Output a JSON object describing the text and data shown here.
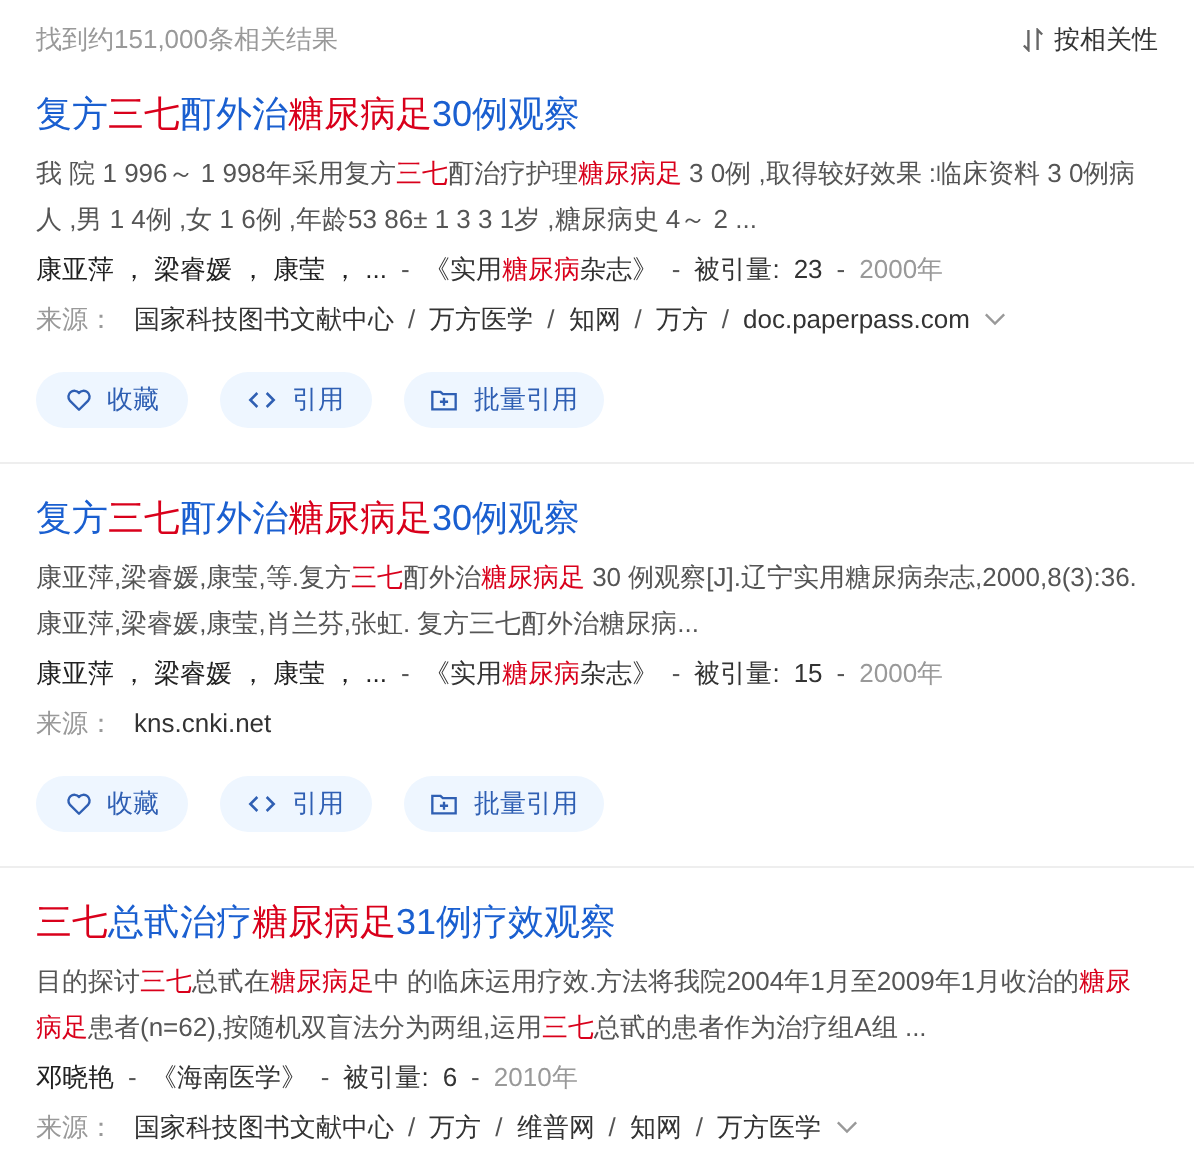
{
  "header": {
    "count_text": "找到约151,000条相关结果",
    "sort_label": "按相关性"
  },
  "results": [
    {
      "title": [
        {
          "text": "复方",
          "hl": false
        },
        {
          "text": "三七",
          "hl": true
        },
        {
          "text": "酊外治",
          "hl": false
        },
        {
          "text": "糖尿病足",
          "hl": true
        },
        {
          "text": "30例观察",
          "hl": false
        }
      ],
      "abstract": [
        {
          "text": "我 院 1 996～ 1 998年采用复方",
          "hl": false
        },
        {
          "text": "三七",
          "hl": true
        },
        {
          "text": "酊治疗护理",
          "hl": false
        },
        {
          "text": "糖尿病足",
          "hl": true
        },
        {
          "text": " 3 0例 ,取得较好效果 :临床资料 3 0例病人 ,男 1 4例 ,女 1 6例 ,年龄53 86± 1 3 3 1岁 ,糖尿病史 4～ 2 ...",
          "hl": false
        }
      ],
      "authors": "康亚萍 ， 梁睿媛 ， 康莹 ， ...",
      "journal": [
        {
          "text": "《实用",
          "hl": false
        },
        {
          "text": "糖尿病",
          "hl": true
        },
        {
          "text": "杂志》",
          "hl": false
        }
      ],
      "cited_label": "被引量:",
      "cited": "23",
      "year": "2000年",
      "meta_separators": [
        "-",
        "-",
        "-"
      ],
      "source_label": "来源：",
      "sources": [
        "国家科技图书文献中心",
        "万方医学",
        "知网",
        "万方",
        "doc.paperpass.com"
      ],
      "source_separators": [
        "/",
        "/",
        "/",
        "/"
      ],
      "sources_expandable": true,
      "actions": [
        {
          "kind": "favorite",
          "label": "收藏"
        },
        {
          "kind": "cite",
          "label": "引用"
        },
        {
          "kind": "batch",
          "label": "批量引用"
        }
      ]
    },
    {
      "title": [
        {
          "text": "复方",
          "hl": false
        },
        {
          "text": "三七",
          "hl": true
        },
        {
          "text": "酊外治",
          "hl": false
        },
        {
          "text": "糖尿病足",
          "hl": true
        },
        {
          "text": "30例观察",
          "hl": false
        }
      ],
      "abstract": [
        {
          "text": "康亚萍,梁睿媛,康莹,等.复方",
          "hl": false
        },
        {
          "text": "三七",
          "hl": true
        },
        {
          "text": "酊外治",
          "hl": false
        },
        {
          "text": "糖尿病足",
          "hl": true
        },
        {
          "text": " 30 例观察[J].辽宁实用糖尿病杂志,2000,8(3):36.康亚萍,梁睿媛,康莹,肖兰芬,张虹. 复方三七酊外治糖尿病...",
          "hl": false
        }
      ],
      "authors": "康亚萍 ， 梁睿媛 ， 康莹 ， ...",
      "journal": [
        {
          "text": "《实用",
          "hl": false
        },
        {
          "text": "糖尿病",
          "hl": true
        },
        {
          "text": "杂志》",
          "hl": false
        }
      ],
      "cited_label": "被引量:",
      "cited": "15",
      "year": "2000年",
      "meta_separators": [
        "-",
        "-",
        "-"
      ],
      "source_label": "来源：",
      "sources": [
        "kns.cnki.net"
      ],
      "sources_expandable": false,
      "actions": [
        {
          "kind": "favorite",
          "label": "收藏"
        },
        {
          "kind": "cite",
          "label": "引用"
        },
        {
          "kind": "batch",
          "label": "批量引用"
        }
      ]
    },
    {
      "title": [
        {
          "text": "三七",
          "hl": true
        },
        {
          "text": "总甙治疗",
          "hl": false
        },
        {
          "text": "糖尿病足",
          "hl": true
        },
        {
          "text": "31例疗效观察",
          "hl": false
        }
      ],
      "abstract": [
        {
          "text": "目的探讨",
          "hl": false
        },
        {
          "text": "三七",
          "hl": true
        },
        {
          "text": "总甙在",
          "hl": false
        },
        {
          "text": "糖尿病足",
          "hl": true
        },
        {
          "text": "中 的临床运用疗效.方法将我院2004年1月至2009年1月收治的",
          "hl": false
        },
        {
          "text": "糖尿病足",
          "hl": true
        },
        {
          "text": "患者(n=62),按随机双盲法分为两组,运用",
          "hl": false
        },
        {
          "text": "三七",
          "hl": true
        },
        {
          "text": "总甙的患者作为治疗组A组 ...",
          "hl": false
        }
      ],
      "authors": "邓晓艳",
      "journal": [
        {
          "text": "《海南医学》",
          "hl": false
        }
      ],
      "cited_label": "被引量:",
      "cited": "6",
      "year": "2010年",
      "meta_separators": [
        "-",
        "-",
        "-"
      ],
      "source_label": "来源：",
      "sources": [
        "国家科技图书文献中心",
        "万方",
        "维普网",
        "知网",
        "万方医学"
      ],
      "source_separators": [
        "/",
        "/",
        "/",
        "/"
      ],
      "sources_expandable": true
    }
  ]
}
